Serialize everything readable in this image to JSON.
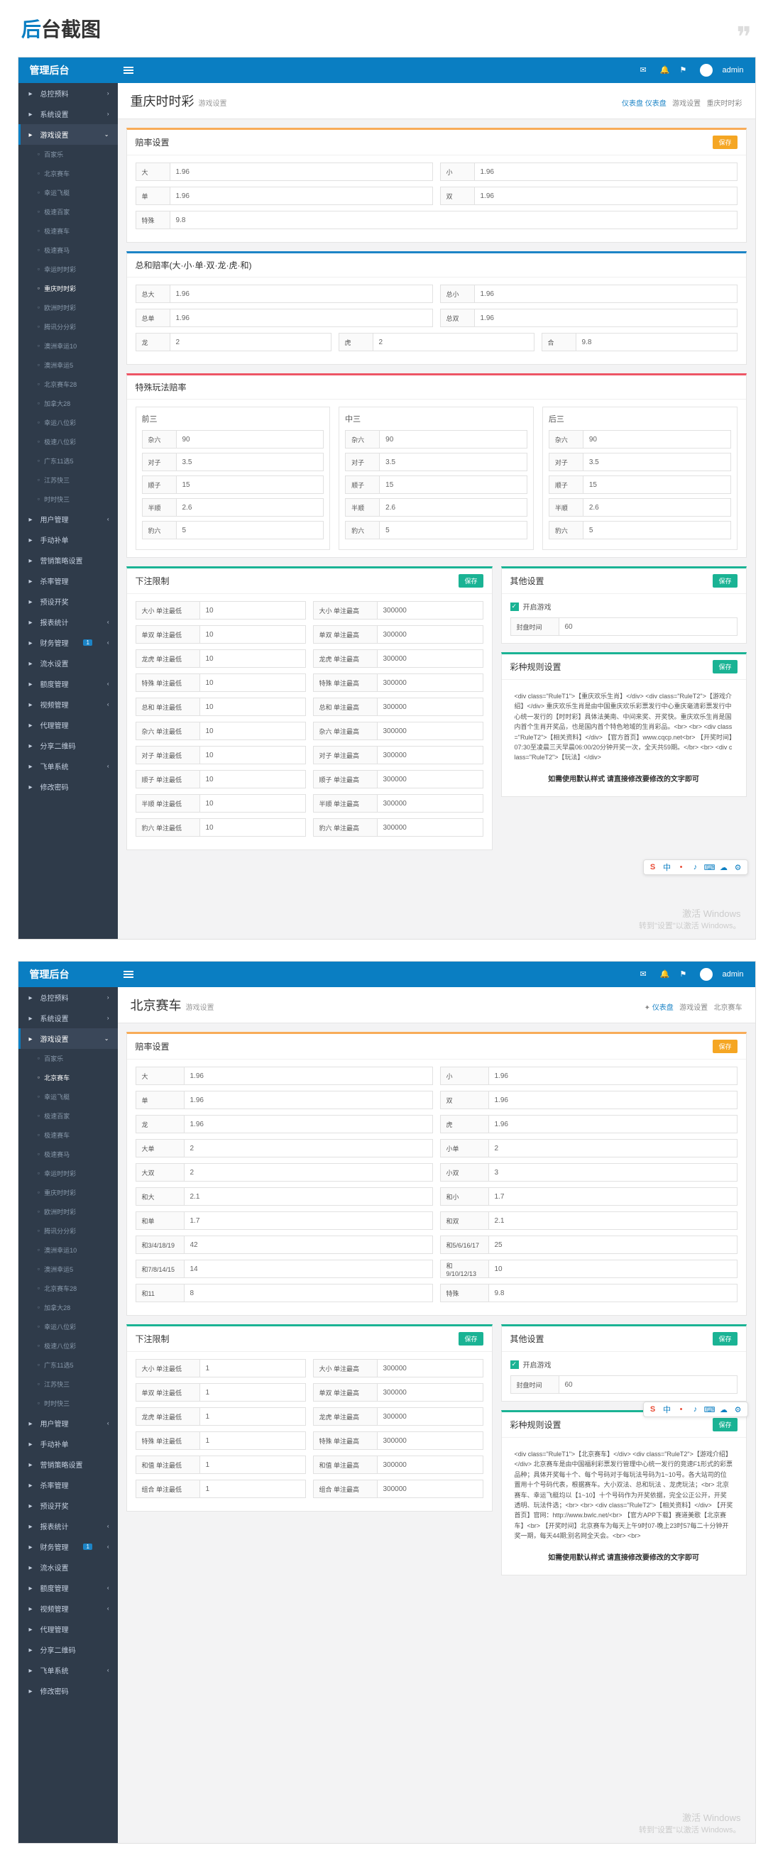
{
  "page_title_1": "后",
  "page_title_2": "台截图",
  "app": {
    "brand": "管理后台",
    "user": "admin",
    "icons": [
      "mail-icon",
      "bell-icon",
      "flag-icon",
      "avatar"
    ]
  },
  "sidebar_top": [
    {
      "label": "总控预料",
      "ico": "dashboard"
    },
    {
      "label": "系统设置",
      "ico": "gear"
    },
    {
      "label": "游戏设置",
      "ico": "game",
      "active": true
    }
  ],
  "sidebar_sub": [
    "百家乐",
    "北京赛车",
    "幸运飞艇",
    "极速百家",
    "极速赛车",
    "极速赛马",
    "幸运时时彩",
    "重庆时时彩",
    "欧洲时时彩",
    "腾讯分分彩",
    "澳洲幸运10",
    "澳洲幸运5",
    "北京赛车28",
    "加拿大28",
    "幸运八位彩",
    "极速八位彩",
    "广东11选5",
    "江苏快三",
    "时时快三"
  ],
  "sidebar_sub2": [
    "百家乐",
    "北京赛车",
    "幸运飞艇",
    "极速百家",
    "极速赛车",
    "极速赛马",
    "幸运时时彩",
    "重庆时时彩",
    "欧洲时时彩",
    "腾讯分分彩",
    "澳洲幸运10",
    "澳洲幸运5",
    "北京赛车28",
    "加拿大28",
    "幸运八位彩",
    "极速八位彩",
    "广东11选5",
    "江苏快三",
    "时时快三"
  ],
  "sidebar_bottom": [
    {
      "label": "用户管理",
      "caret": true
    },
    {
      "label": "手动补单",
      "ico": "edit"
    },
    {
      "label": "营销策略设置",
      "ico": "bullhorn"
    },
    {
      "label": "杀率管理",
      "ico": "target"
    },
    {
      "label": "预设开奖",
      "ico": "gift"
    },
    {
      "label": "报表统计",
      "caret": true
    },
    {
      "label": "财务管理",
      "caret": true,
      "badge": "1"
    },
    {
      "label": "流水设置",
      "ico": "water"
    },
    {
      "label": "额度管理",
      "caret": true
    },
    {
      "label": "视频管理",
      "caret": true
    },
    {
      "label": "代理管理",
      "ico": "users"
    },
    {
      "label": "分享二维码",
      "ico": "qr"
    },
    {
      "label": "飞单系统",
      "caret": true
    },
    {
      "label": "修改密码",
      "ico": "lock"
    }
  ],
  "screen1": {
    "title": "重庆时时彩",
    "sub": "游戏设置",
    "crumb": {
      "home": "仪表盘",
      "mid": "游戏设置",
      "cur": "重庆时时彩"
    },
    "rate_panel": {
      "title": "赔率设置",
      "save": "保存",
      "rows": [
        {
          "lbl1": "大",
          "val1": "1.96",
          "lbl2": "小",
          "val2": "1.96"
        },
        {
          "lbl1": "单",
          "val1": "1.96",
          "lbl2": "双",
          "val2": "1.96"
        }
      ],
      "special": {
        "lbl": "特殊",
        "val": "9.8"
      }
    },
    "sum_panel": {
      "title": "总和赔率(大·小·单·双·龙·虎·和)",
      "rows": [
        {
          "lbl1": "总大",
          "val1": "1.96",
          "lbl2": "总小",
          "val2": "1.96"
        },
        {
          "lbl1": "总单",
          "val1": "1.96",
          "lbl2": "总双",
          "val2": "1.96"
        }
      ],
      "triple": [
        {
          "lbl": "龙",
          "val": "2"
        },
        {
          "lbl": "虎",
          "val": "2"
        },
        {
          "lbl": "合",
          "val": "9.8"
        }
      ]
    },
    "special_panel": {
      "title": "特殊玩法赔率",
      "cols": [
        "前三",
        "中三",
        "后三"
      ],
      "fields": [
        {
          "lbl": "杂六",
          "val": "90"
        },
        {
          "lbl": "对子",
          "val": "3.5"
        },
        {
          "lbl": "顺子",
          "val": "15"
        },
        {
          "lbl": "半顺",
          "val": "2.6"
        },
        {
          "lbl": "豹六",
          "val": "5"
        }
      ]
    },
    "limit_panel": {
      "title": "下注限制",
      "save": "保存",
      "rows": [
        {
          "l1": "大小 单注最低",
          "v1": "10",
          "l2": "大小 单注最高",
          "v2": "300000"
        },
        {
          "l1": "单双 单注最低",
          "v1": "10",
          "l2": "单双 单注最高",
          "v2": "300000"
        },
        {
          "l1": "龙虎 单注最低",
          "v1": "10",
          "l2": "龙虎 单注最高",
          "v2": "300000"
        },
        {
          "l1": "特殊 单注最低",
          "v1": "10",
          "l2": "特殊 单注最高",
          "v2": "300000"
        },
        {
          "l1": "总和 单注最低",
          "v1": "10",
          "l2": "总和 单注最高",
          "v2": "300000"
        },
        {
          "l1": "杂六 单注最低",
          "v1": "10",
          "l2": "杂六 单注最高",
          "v2": "300000"
        },
        {
          "l1": "对子 单注最低",
          "v1": "10",
          "l2": "对子 单注最高",
          "v2": "300000"
        },
        {
          "l1": "顺子 单注最低",
          "v1": "10",
          "l2": "顺子 单注最高",
          "v2": "300000"
        },
        {
          "l1": "半顺 单注最低",
          "v1": "10",
          "l2": "半顺 单注最高",
          "v2": "300000"
        },
        {
          "l1": "豹六 单注最低",
          "v1": "10",
          "l2": "豹六 单注最高",
          "v2": "300000"
        }
      ]
    },
    "other_panel": {
      "title": "其他设置",
      "save": "保存",
      "toggle": "开启游戏",
      "closetime_lbl": "封盘时间",
      "closetime_val": "60"
    },
    "rule_panel": {
      "title": "彩种规则设置",
      "save": "保存",
      "html": "<div class=\"RuleT1\">【重庆欢乐生肖】</div>\n<div class=\"RuleT2\">【游戏介绍】</div>\n重庆欢乐生肖是由中国重庆欢乐彩票发行中心重庆毫清彩票发行中心统一发行的【时时彩】具体法美南、中间来奖、开奖快。重庆欢乐生肖是国内首个生肖开奖品，也是国内首个特色地域的生肖彩品。<br>\n<br>\n<div class=\"RuleT2\">【相关资料】</div>\n【官方首页】www.cqcp.net<br>\n【开奖时间】07:30至凌晨三天早晨06:00/20分钟开奖一次，全天共59期。</br>\n<br>\n<div class=\"RuleT2\">【玩法】</div>",
      "note": "如需使用默认样式 请直接修改要修改的文字即可"
    }
  },
  "screen2": {
    "title": "北京赛车",
    "sub": "游戏设置",
    "crumb": {
      "home": "仪表盘",
      "mid": "游戏设置",
      "cur": "北京赛车"
    },
    "rate_panel": {
      "title": "赔率设置",
      "save": "保存",
      "rows": [
        {
          "lbl1": "大",
          "val1": "1.96",
          "lbl2": "小",
          "val2": "1.96"
        },
        {
          "lbl1": "单",
          "val1": "1.96",
          "lbl2": "双",
          "val2": "1.96"
        },
        {
          "lbl1": "龙",
          "val1": "1.96",
          "lbl2": "虎",
          "val2": "1.96"
        },
        {
          "lbl1": "大单",
          "val1": "2",
          "lbl2": "小单",
          "val2": "2"
        },
        {
          "lbl1": "大双",
          "val1": "2",
          "lbl2": "小双",
          "val2": "3"
        },
        {
          "lbl1": "和大",
          "val1": "2.1",
          "lbl2": "和小",
          "val2": "1.7"
        },
        {
          "lbl1": "和单",
          "val1": "1.7",
          "lbl2": "和双",
          "val2": "2.1"
        },
        {
          "lbl1": "和3/4/18/19",
          "val1": "42",
          "lbl2": "和5/6/16/17",
          "val2": "25"
        },
        {
          "lbl1": "和7/8/14/15",
          "val1": "14",
          "lbl2": "和9/10/12/13",
          "val2": "10"
        },
        {
          "lbl1": "和11",
          "val1": "8",
          "lbl2": "特殊",
          "val2": "9.8"
        }
      ]
    },
    "limit_panel": {
      "title": "下注限制",
      "save": "保存",
      "rows": [
        {
          "l1": "大小 单注最低",
          "v1": "1",
          "l2": "大小 单注最高",
          "v2": "300000"
        },
        {
          "l1": "单双 单注最低",
          "v1": "1",
          "l2": "单双 单注最高",
          "v2": "300000"
        },
        {
          "l1": "龙虎 单注最低",
          "v1": "1",
          "l2": "龙虎 单注最高",
          "v2": "300000"
        },
        {
          "l1": "特殊 单注最低",
          "v1": "1",
          "l2": "特殊 单注最高",
          "v2": "300000"
        },
        {
          "l1": "和值 单注最低",
          "v1": "1",
          "l2": "和值 单注最高",
          "v2": "300000"
        },
        {
          "l1": "组合 单注最低",
          "v1": "1",
          "l2": "组合 单注最高",
          "v2": "300000"
        }
      ]
    },
    "other_panel": {
      "title": "其他设置",
      "save": "保存",
      "toggle": "开启游戏",
      "closetime_lbl": "封盘时间",
      "closetime_val": "60"
    },
    "rule_panel": {
      "title": "彩种规则设置",
      "save": "保存",
      "html": "<div class=\"RuleT1\">【北京赛车】</div>\n<div class=\"RuleT2\">【游戏介绍】</div>\n北京赛车是由中国福利彩票发行管理中心统一发行的竞速F1形式的彩票品种；具体开奖每十个、每个号码对于每玩法号码为1~10号。各大站司的位置用十个号码代表，根据赛车。大小双法、总和玩法 、龙虎玩法；<br>\n北京赛车、幸运飞艇均以【1~10】十个号码作为开奖依据，完全公正公开，开奖透明、玩法件选；<br>\n<br>\n<div class=\"RuleT2\">【相关资料】</div>\n【开奖首页】官网：http://www.bwlc.net/<br>\n【官方APP下载】赛道美歌【北京赛车】<br>\n【开奖时间】北京赛车为每天上午9时07-晚上23时57每二十分钟开奖一期，每天44期;别名网全天会。<br>\n<br>",
      "note": "如需使用默认样式 请直接修改要修改的文字即可"
    }
  },
  "watermark": {
    "w1": "激活 Windows",
    "w2": "转到\"设置\"以激活 Windows。"
  },
  "floatbar": [
    "S",
    "中",
    "•",
    "♪",
    "⌨",
    "☁",
    "⚙"
  ]
}
